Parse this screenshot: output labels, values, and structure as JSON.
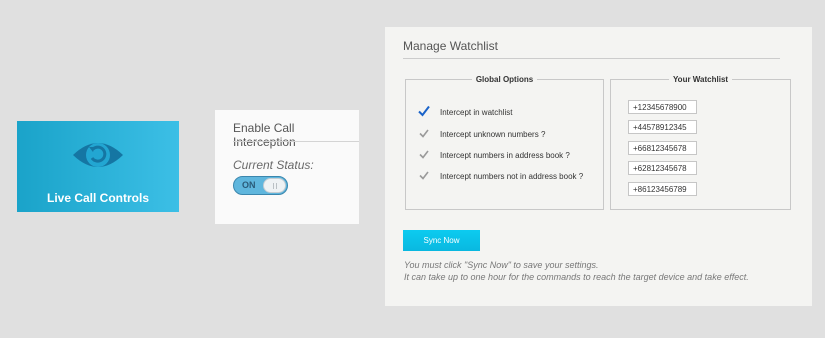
{
  "tile": {
    "label": "Live Call Controls",
    "icon": "eye-refresh-icon",
    "color": "#2ab0d8"
  },
  "intercept": {
    "title": "Enable Call Interception",
    "status_label": "Current Status:",
    "toggle_label": "ON",
    "toggle_on": true
  },
  "watchlist": {
    "title": "Manage Watchlist",
    "global_legend": "Global Options",
    "your_legend": "Your Watchlist",
    "options": [
      {
        "label": "Intercept in watchlist",
        "checked": true
      },
      {
        "label": "Intercept unknown numbers ?",
        "checked": false
      },
      {
        "label": "Intercept numbers in address book ?",
        "checked": false
      },
      {
        "label": "Intercept numbers not in address book ?",
        "checked": false
      }
    ],
    "numbers": [
      "+12345678900",
      "+44578912345",
      "+66812345678",
      "+62812345678",
      "+86123456789"
    ],
    "sync_label": "Sync Now",
    "note_line1": "You must click \"Sync Now\" to save your settings.",
    "note_line2": "It can take up to one hour for the commands to reach the target device and take effect."
  },
  "colors": {
    "page_bg": "#e0e0e0",
    "accent": "#0ccbf0",
    "check_active": "#1a63c9",
    "check_inactive": "#9a9a9a"
  }
}
